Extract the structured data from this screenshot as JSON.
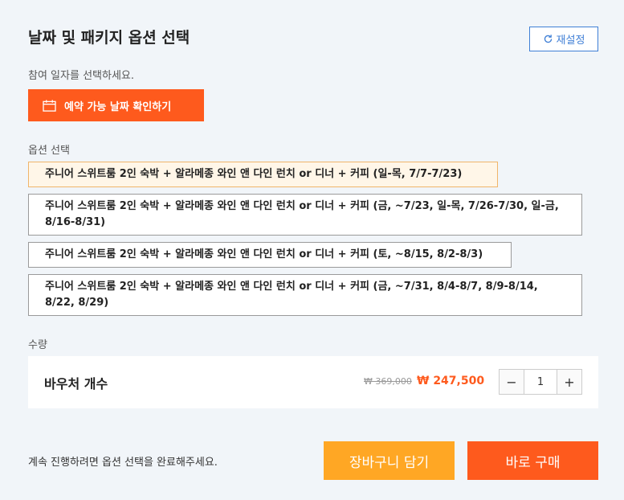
{
  "header": {
    "title": "날짜 및 패키지 옵션 선택",
    "reset_label": "재설정"
  },
  "date": {
    "hint": "참여 일자를 선택하세요.",
    "button_label": "예약 가능 날짜 확인하기"
  },
  "options": {
    "label": "옵션 선택",
    "items": [
      {
        "label": "주니어 스위트룸 2인 숙박 + 알라메종 와인 앤 다인 런치 or 디너 + 커피 (일-목, 7/7-7/23)",
        "selected": true
      },
      {
        "label": "주니어 스위트룸 2인 숙박 + 알라메종 와인 앤 다인 런치 or 디너 + 커피 (금, ~7/23, 일-목, 7/26-7/30, 일-금, 8/16-8/31)",
        "selected": false
      },
      {
        "label": "주니어 스위트룸 2인 숙박 + 알라메종 와인 앤 다인 런치 or 디너 + 커피 (토, ~8/15, 8/2-8/3)",
        "selected": false
      },
      {
        "label": "주니어 스위트룸 2인 숙박 + 알라메종 와인 앤 다인 런치 or 디너 + 커피 (금, ~7/31, 8/4-8/7, 8/9-8/14, 8/22, 8/29)",
        "selected": false
      }
    ]
  },
  "quantity": {
    "label": "수량",
    "item_name": "바우처 개수",
    "original_price": "₩ 369,000",
    "sale_price": "₩ 247,500",
    "value": "1",
    "minus": "−",
    "plus": "+"
  },
  "footer": {
    "note": "계속 진행하려면 옵션 선택을 완료해주세요.",
    "cart_label": "장바구니 담기",
    "buy_label": "바로 구매"
  },
  "colors": {
    "accent": "#fe5a1d",
    "cart": "#ffa724",
    "reset": "#3f7fd6",
    "selected_bg": "#fff6e8"
  }
}
